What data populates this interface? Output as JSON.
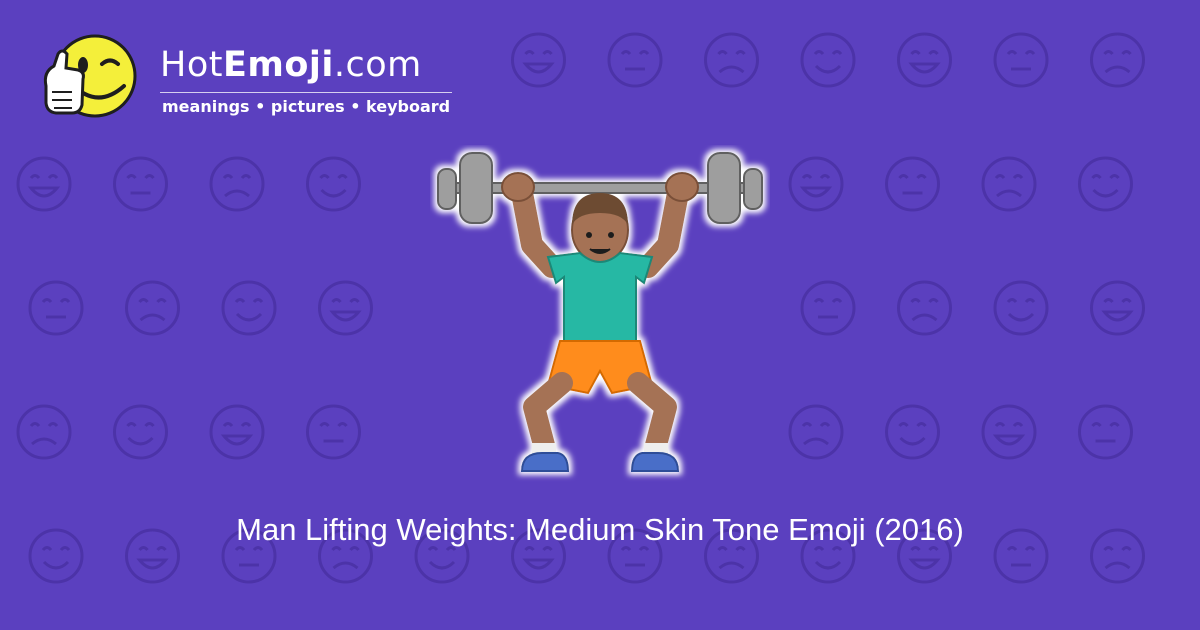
{
  "brand": {
    "name_prefix": "Hot",
    "name_bold": "Emoji",
    "name_suffix": ".com",
    "tagline": "meanings • pictures • keyboard",
    "logo_icon": "winking-thumbs-up-face-icon"
  },
  "hero": {
    "icon": "man-lifting-weights-medium-skin-tone-icon"
  },
  "caption": "Man Lifting Weights: Medium Skin Tone Emoji (2016)",
  "colors": {
    "background": "#5b40bf",
    "pattern": "#4c33a8",
    "text": "#ffffff",
    "logo_yellow": "#f4ef3a",
    "shirt": "#26b8a4",
    "shorts": "#ff8c1a",
    "skin": "#a57255",
    "shoes": "#4a6ec8"
  }
}
